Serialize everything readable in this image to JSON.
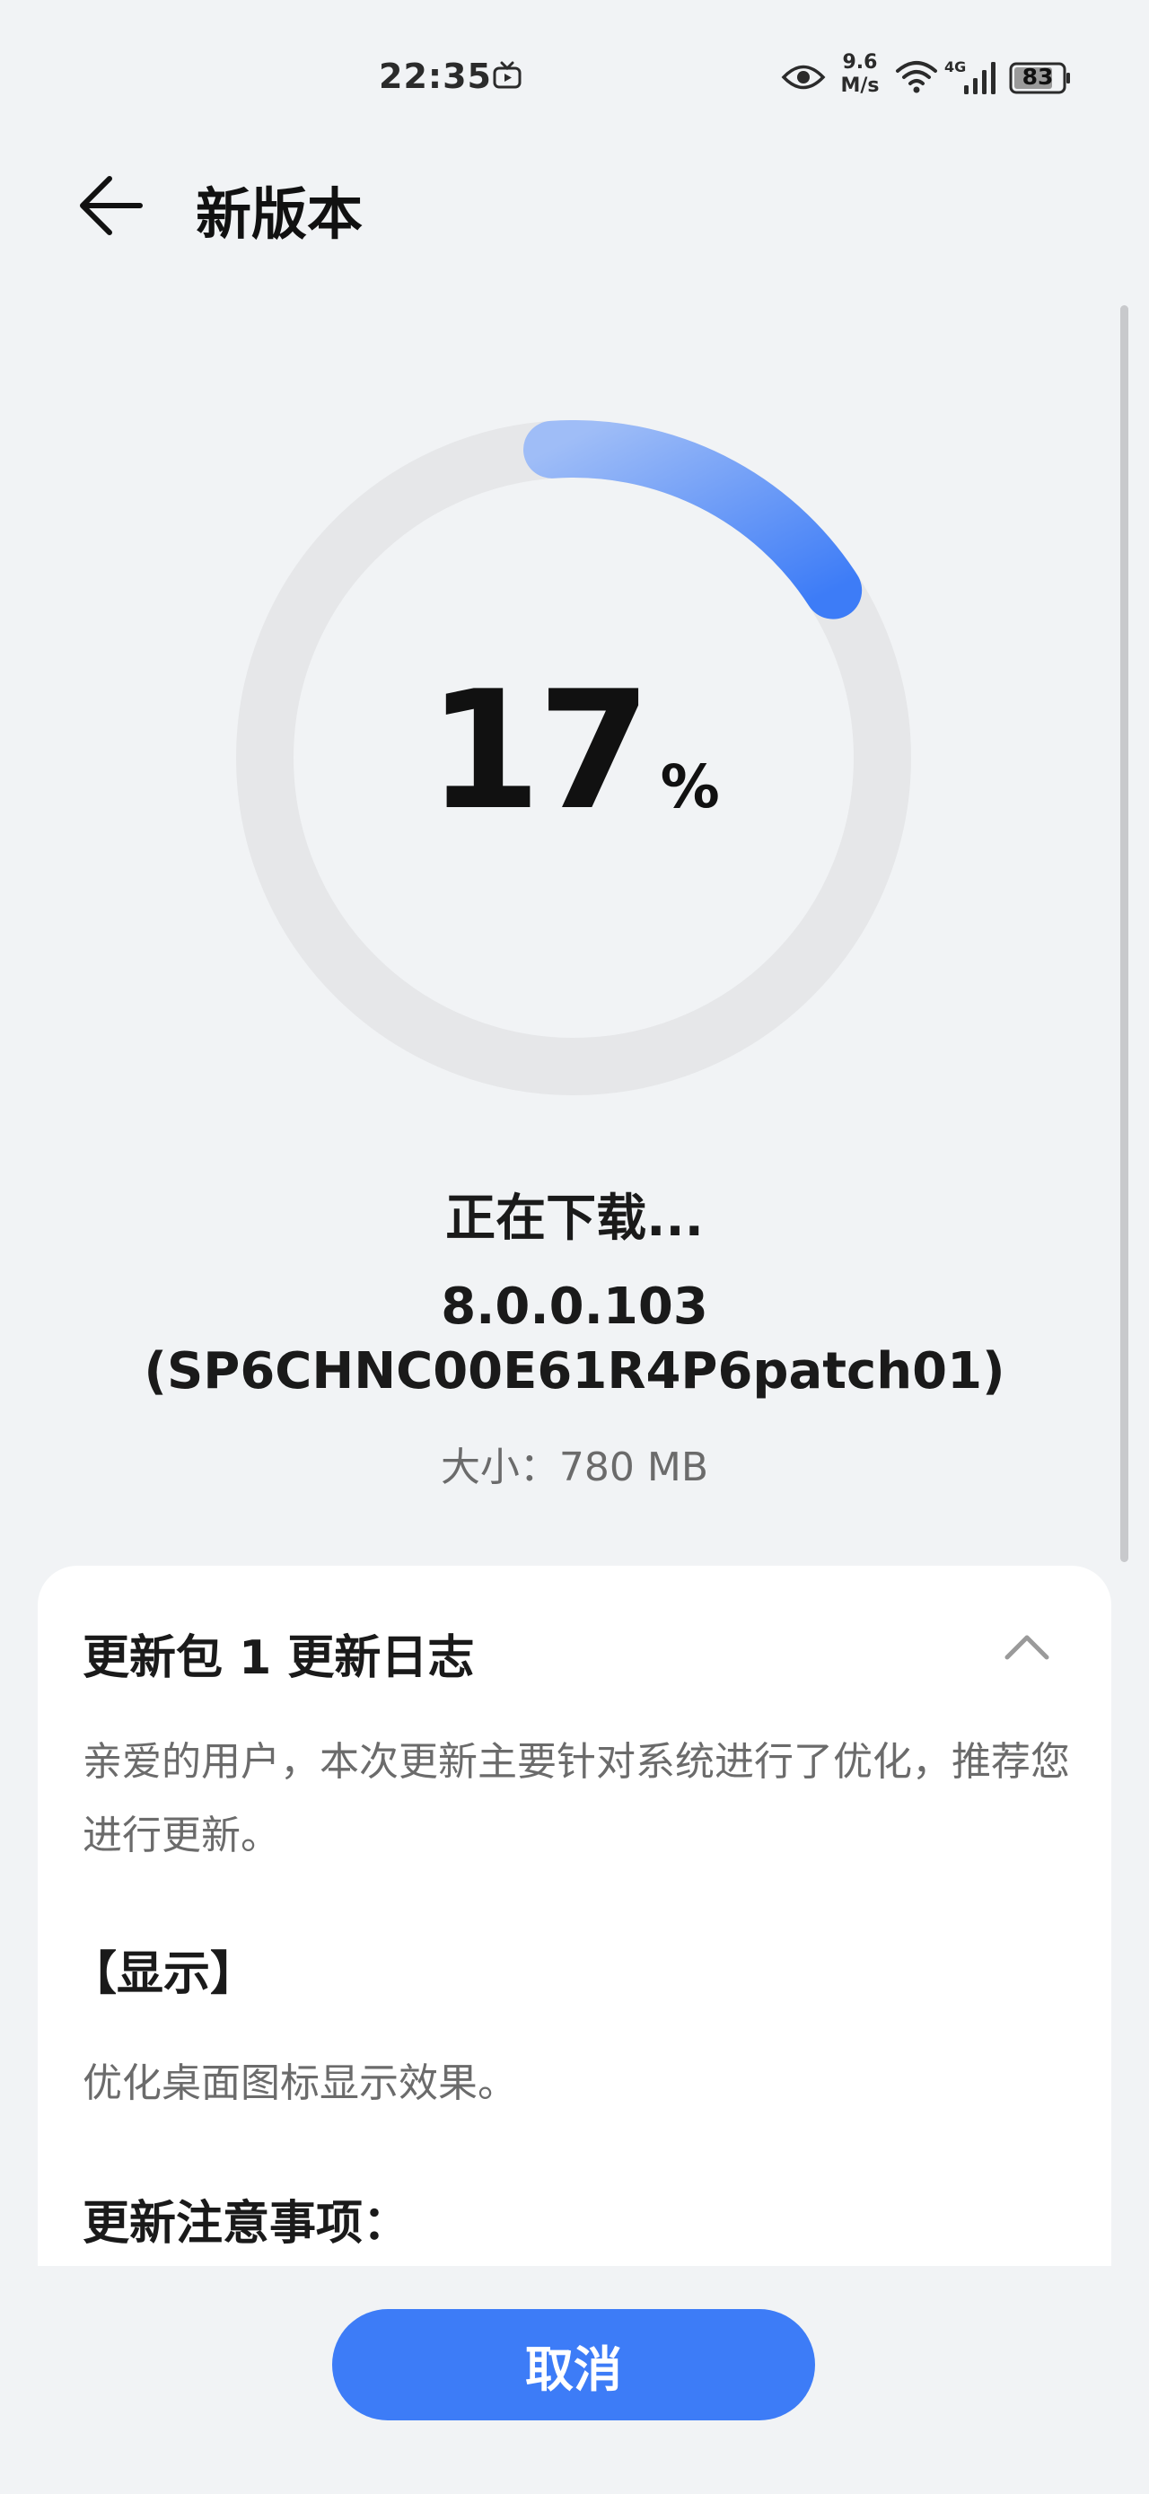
{
  "status_bar": {
    "time": "22:35",
    "speed_value": "9.6",
    "speed_unit": "M/s",
    "network_type": "4G",
    "battery": "83",
    "icons": [
      "tv-icon",
      "eye-icon",
      "wifi-icon",
      "signal-icon",
      "battery-icon"
    ]
  },
  "header": {
    "title": "新版本",
    "back_icon": "arrow-left-icon"
  },
  "download": {
    "progress": 17,
    "percent_sign": "%",
    "status": "正在下载...",
    "version_line1": "8.0.0.103",
    "version_line2": "(SP6CHNC00E61R4P6patch01)",
    "size": "大小：780 MB"
  },
  "changelog": {
    "title": "更新包 1 更新日志",
    "intro": "亲爱的用户，本次更新主要针对系统进行了优化，推荐您进行更新。",
    "section_title": "【显示】",
    "section_body": "优化桌面图标显示效果。",
    "notes_title": "更新注意事项："
  },
  "actions": {
    "cancel_label": "取消"
  },
  "colors": {
    "accent": "#3d7cf7",
    "ring_track": "#e6e7e9",
    "background": "#f1f3f5"
  }
}
